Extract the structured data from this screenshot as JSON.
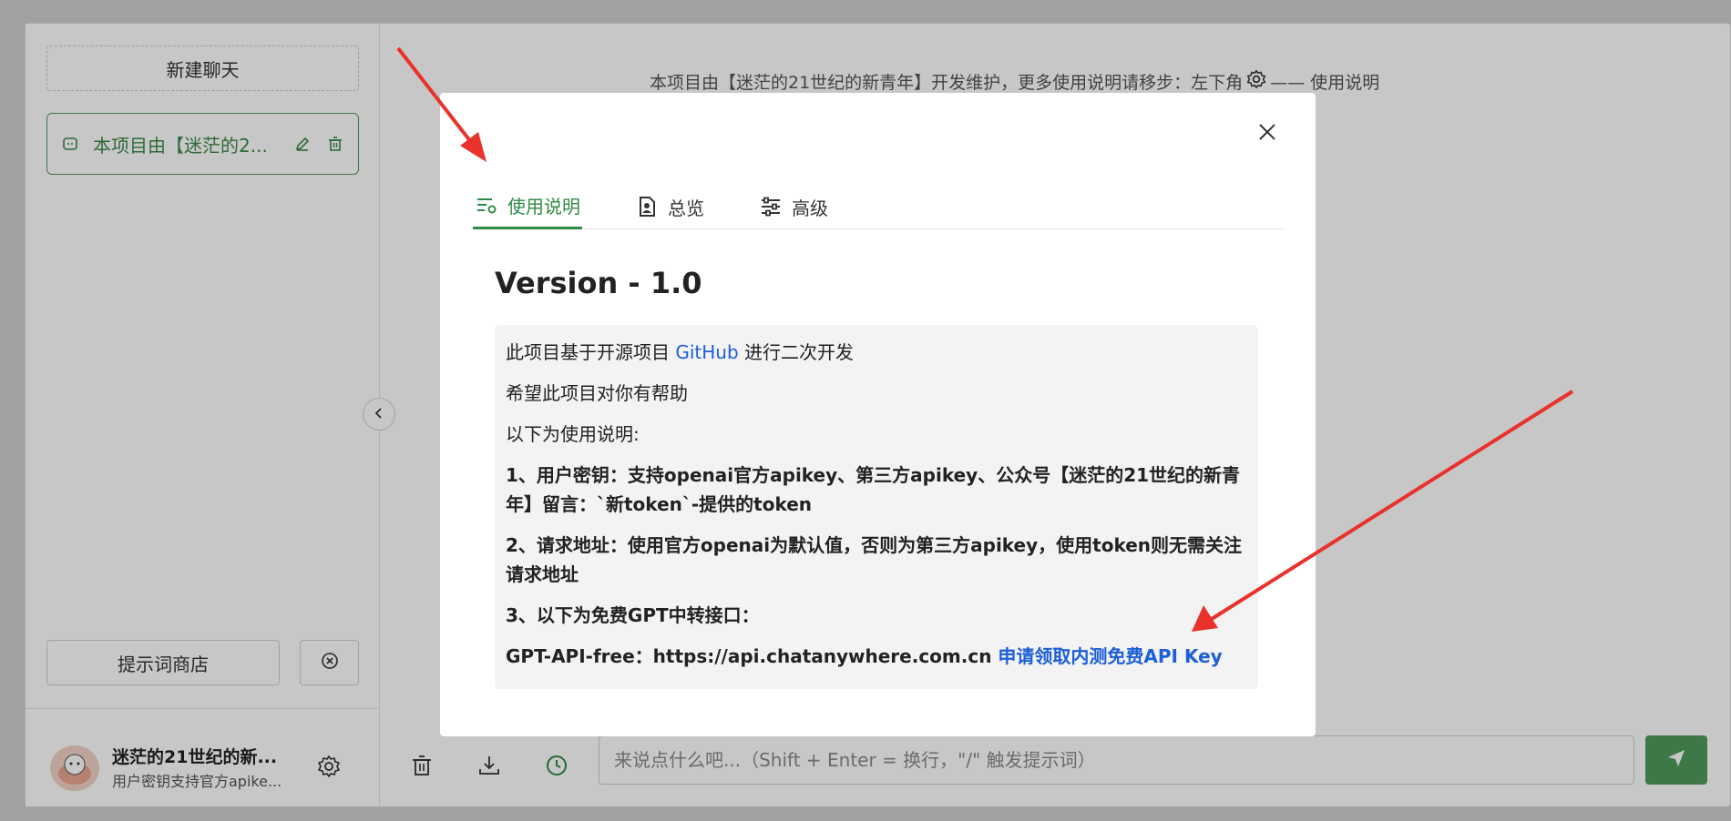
{
  "sidebar": {
    "new_chat_label": "新建聊天",
    "chat_items": [
      {
        "title": "本项目由【迷茫的2..."
      }
    ],
    "prompt_store_label": "提示词商店",
    "user": {
      "name": "迷茫的21世纪的新...",
      "subtitle": "用户密钥支持官方apike..."
    }
  },
  "main": {
    "notice_text": "本项目由【迷茫的21世纪的新青年】开发维护，更多使用说明请移步：左下角",
    "notice_suffix": "—— 使用说明",
    "input": {
      "placeholder": "来说点什么吧...（Shift + Enter = 换行，\"/\" 触发提示词）",
      "value": ""
    }
  },
  "modal": {
    "tabs": [
      {
        "label": "使用说明",
        "icon": "settings-list-icon",
        "active": true
      },
      {
        "label": "总览",
        "icon": "account-box-icon",
        "active": false
      },
      {
        "label": "高级",
        "icon": "sliders-icon",
        "active": false
      }
    ],
    "version_title": "Version - 1.0",
    "line1_prefix": "此项目基于开源项目 ",
    "line1_link": "GitHub",
    "line1_suffix": " 进行二次开发",
    "line2": "希望此项目对你有帮助",
    "line3": "以下为使用说明:",
    "item1": "1、用户密钥：支持openai官方apikey、第三方apikey、公众号【迷茫的21世纪的新青年】留言：`新token`-提供的token",
    "item2": "2、请求地址：使用官方openai为默认值，否则为第三方apikey，使用token则无需关注请求地址",
    "item3": "3、以下为免费GPT中转接口：",
    "api_prefix": "GPT-API-free：https://api.chatanywhere.com.cn ",
    "api_link": "申请领取内测免费API Key"
  },
  "colors": {
    "accent": "#2f8a44",
    "link": "#1d5fd6",
    "arrow": "#e8322b",
    "send_button": "#4f9a5c"
  }
}
